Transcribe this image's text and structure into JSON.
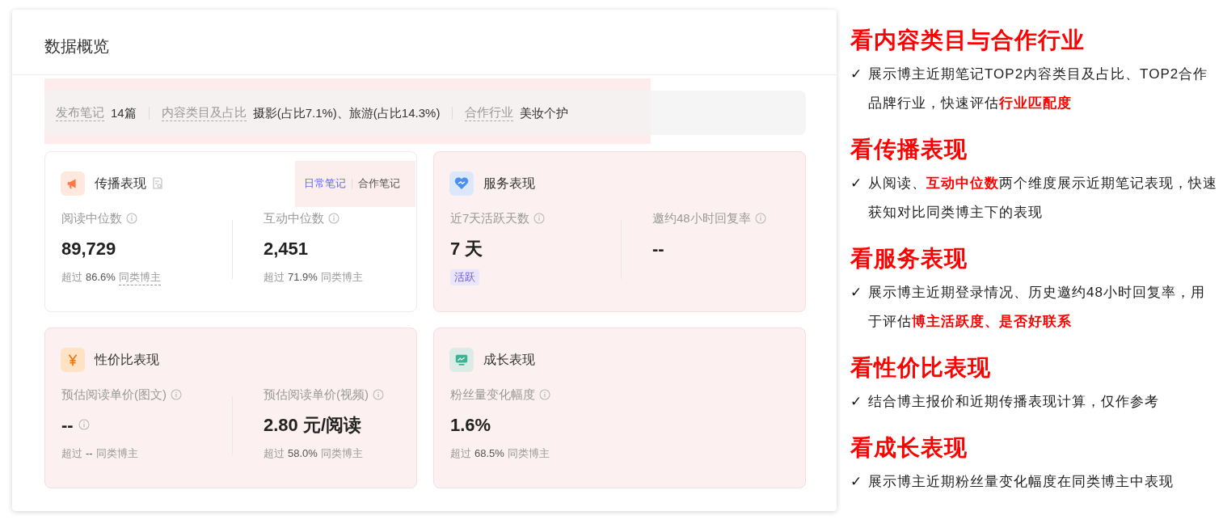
{
  "panel": {
    "title": "数据概览"
  },
  "summary": {
    "highlighted": true,
    "items": [
      {
        "label": "发布笔记",
        "value": "14篇"
      },
      {
        "label": "内容类目及占比",
        "value": "摄影(占比7.1%)、旅游(占比14.3%)"
      },
      {
        "label": "合作行业",
        "value": "美妆个护"
      }
    ]
  },
  "cards": [
    {
      "kind": "megaphone",
      "title": "传播表现",
      "doc_icon": true,
      "highlighted": false,
      "tabs_highlighted": true,
      "tabs": [
        {
          "label": "日常笔记",
          "selected": true
        },
        {
          "label": "合作笔记",
          "selected": false
        }
      ],
      "metrics": [
        {
          "label": "阅读中位数",
          "info": true,
          "value": "89,729",
          "value_info": false,
          "prefix": "超过",
          "figure": "86.6%",
          "suffix": "同类博主",
          "suffix_underlined": true
        },
        {
          "label": "互动中位数",
          "info": true,
          "value": "2,451",
          "value_info": false,
          "prefix": "超过",
          "figure": "71.9%",
          "suffix": "同类博主",
          "suffix_underlined": false
        }
      ]
    },
    {
      "kind": "heart",
      "title": "服务表现",
      "doc_icon": false,
      "highlighted": true,
      "metrics": [
        {
          "label": "近7天活跃天数",
          "info": true,
          "value": "7 天",
          "value_info": false,
          "badge": "活跃"
        },
        {
          "label": "邀约48小时回复率",
          "info": true,
          "value": "--",
          "value_info": false
        }
      ]
    },
    {
      "kind": "yen",
      "title": "性价比表现",
      "doc_icon": false,
      "highlighted": true,
      "metrics": [
        {
          "label": "预估阅读单价(图文)",
          "info": true,
          "value": "--",
          "value_info": true,
          "prefix": "超过",
          "figure": "--",
          "suffix": "同类博主",
          "suffix_underlined": false
        },
        {
          "label": "预估阅读单价(视频)",
          "info": true,
          "value": "2.80 元/阅读",
          "value_info": false,
          "prefix": "超过",
          "figure": "58.0%",
          "suffix": "同类博主",
          "suffix_underlined": false
        }
      ]
    },
    {
      "kind": "monitor",
      "title": "成长表现",
      "doc_icon": false,
      "highlighted": true,
      "metrics": [
        {
          "label": "粉丝量变化幅度",
          "info": true,
          "value": "1.6%",
          "value_info": false,
          "prefix": "超过",
          "figure": "68.5%",
          "suffix": "同类博主",
          "suffix_underlined": false
        }
      ]
    }
  ],
  "notes": [
    {
      "heading": "看内容类目与合作行业",
      "bullets": [
        {
          "check": "✓",
          "text": "展示博主近期笔记TOP2内容类目及占比、TOP2合作品牌行业，快速评估**行业匹配度**"
        }
      ]
    },
    {
      "heading": "看传播表现",
      "bullets": [
        {
          "check": "✓",
          "text": "从阅读、**互动中位数**两个维度展示近期笔记表现，快速获知对比同类博主下的表现"
        }
      ]
    },
    {
      "heading": "看服务表现",
      "bullets": [
        {
          "check": "✓",
          "text": "展示博主近期登录情况、历史邀约48小时回复率，用于评估**博主活跃度、是否好联系**"
        }
      ]
    },
    {
      "heading": "看性价比表现",
      "bullets": [
        {
          "check": "✓",
          "text": "结合博主报价和近期传播表现计算，仅作参考"
        }
      ]
    },
    {
      "heading": "看成长表现",
      "bullets": [
        {
          "check": "✓",
          "text": "展示博主近期粉丝量变化幅度在同类博主中表现"
        }
      ]
    }
  ]
}
